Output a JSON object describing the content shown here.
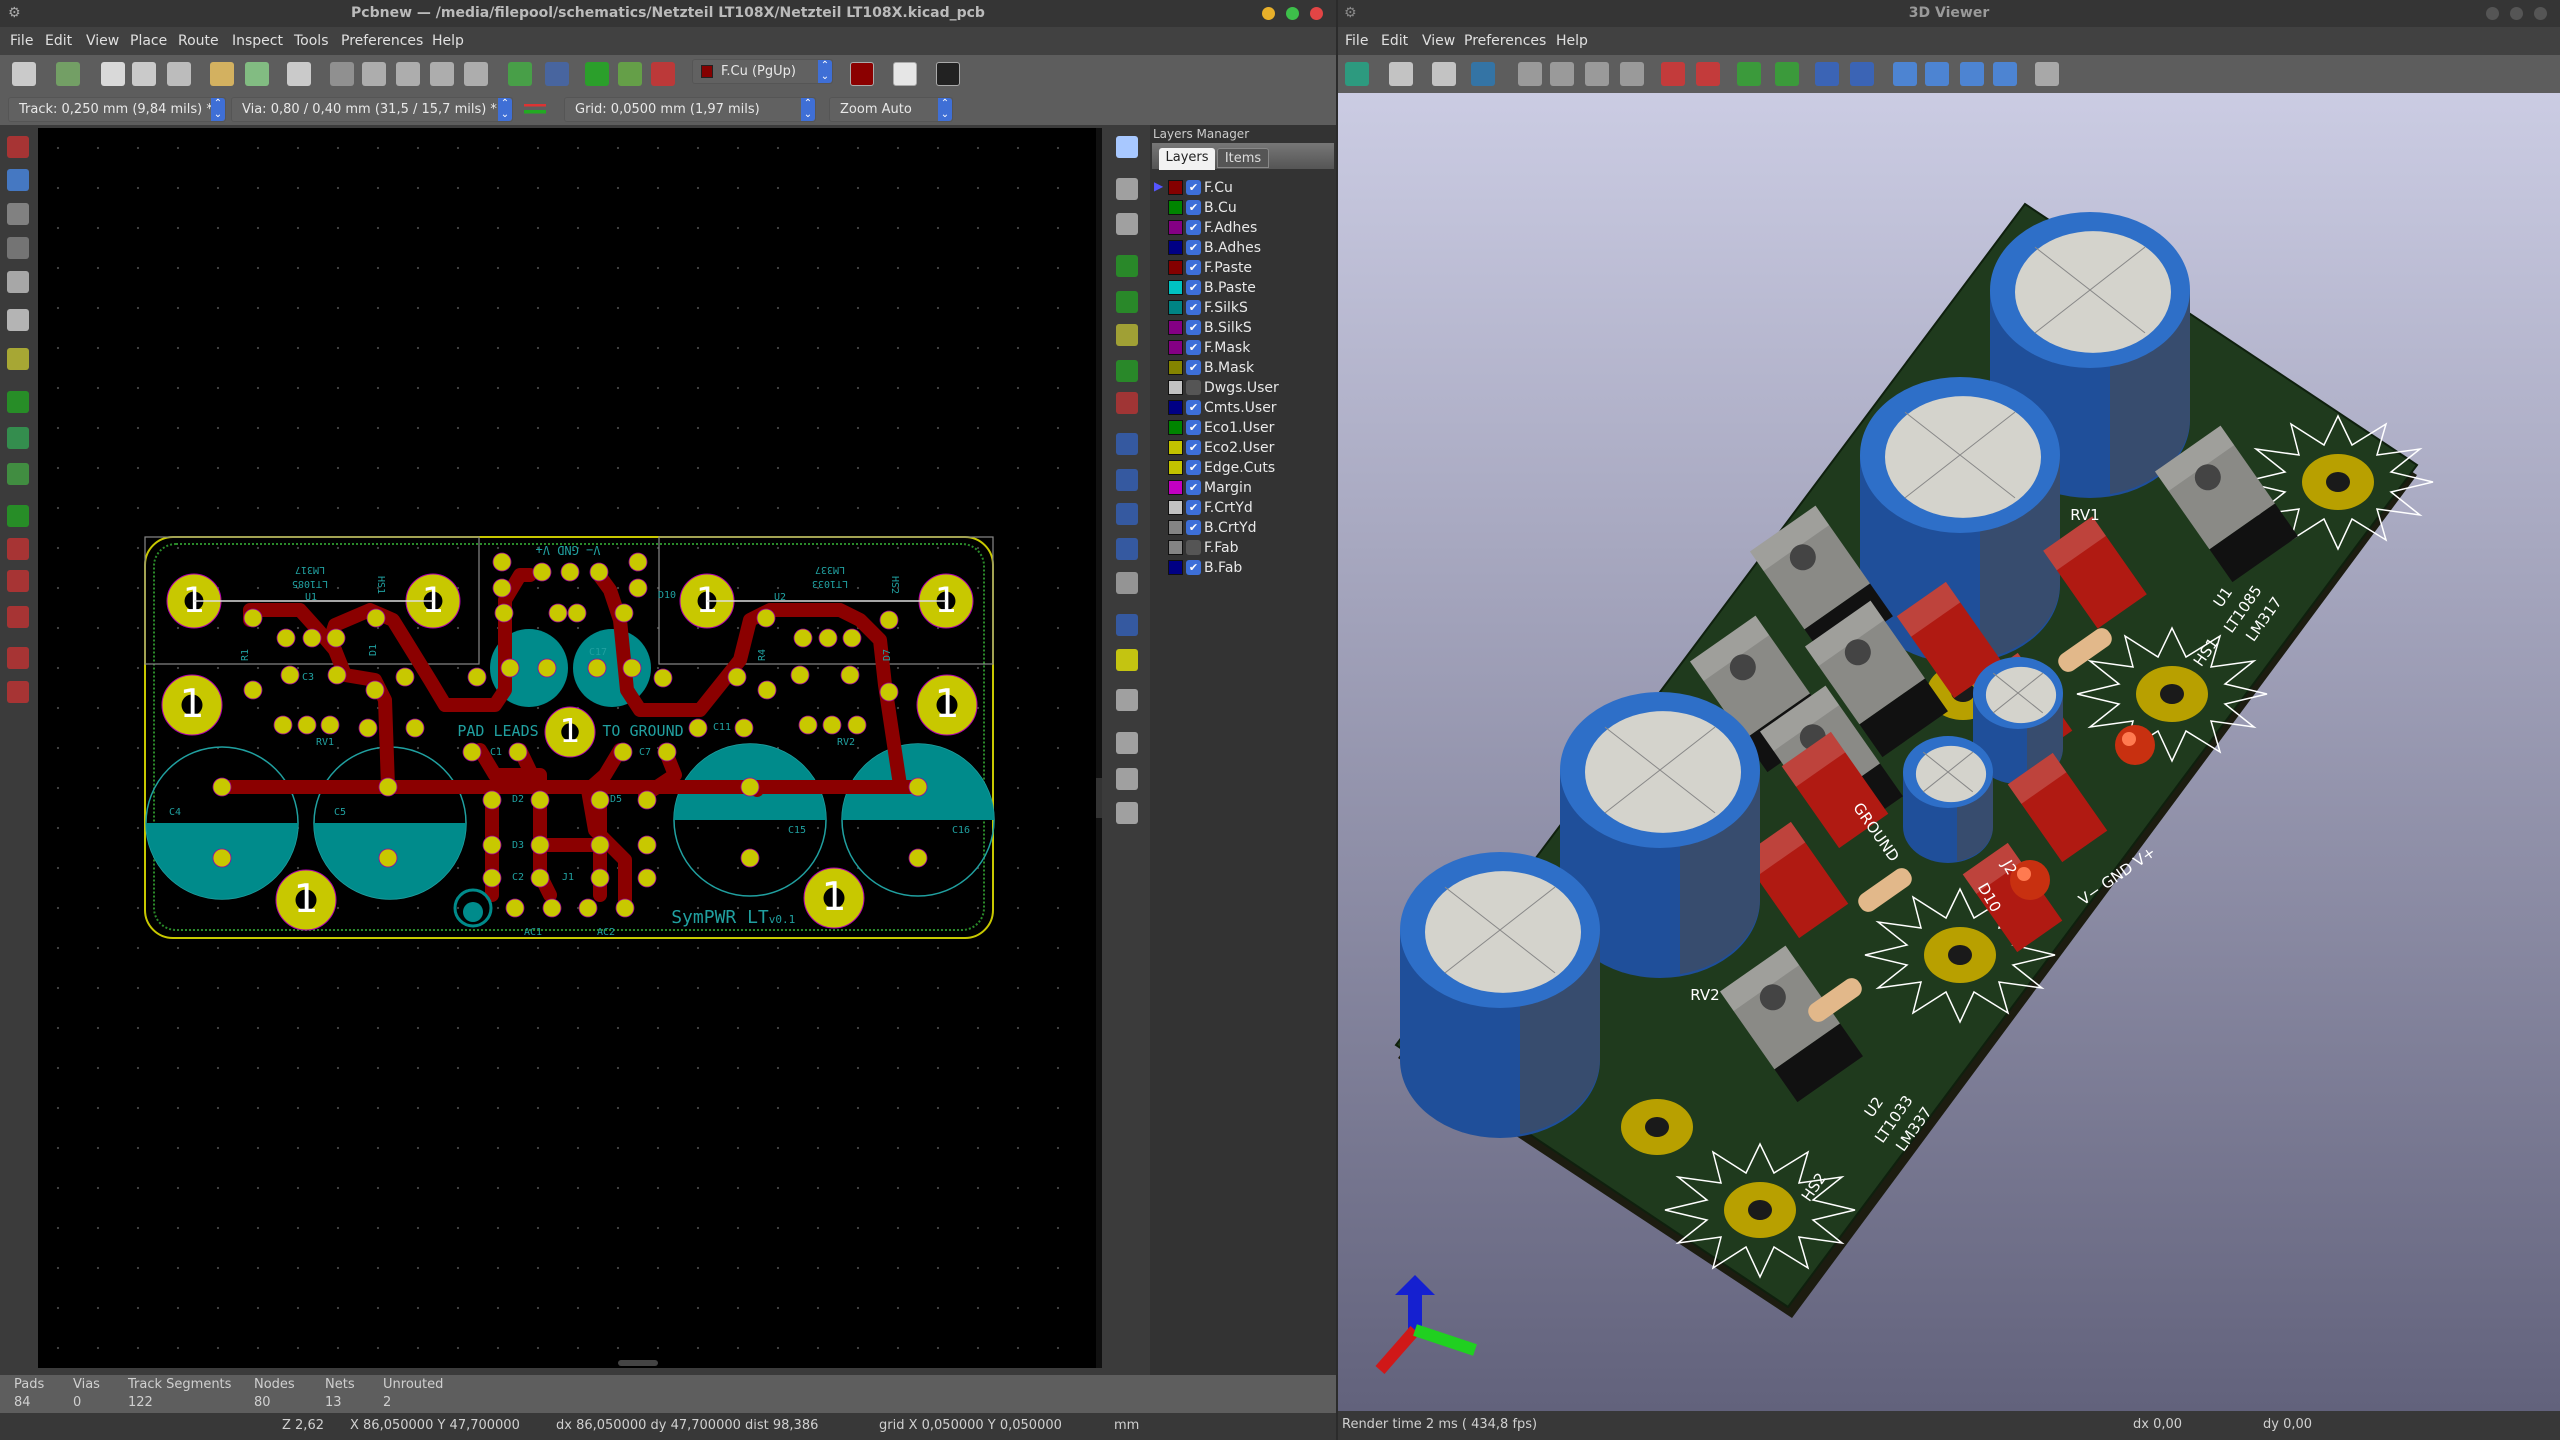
{
  "pcbnew": {
    "title": "Pcbnew — /media/filepool/schematics/Netzteil LT108X/Netzteil LT108X.kicad_pcb",
    "menu": [
      "File",
      "Edit",
      "View",
      "Place",
      "Route",
      "Inspect",
      "Tools",
      "Preferences",
      "Help"
    ],
    "toolbar_icons": [
      "new-board-icon",
      "board-setup-icon",
      "page-settings-icon",
      "print-icon",
      "plot-icon",
      "undo-icon",
      "redo-icon",
      "find-icon",
      "redraw-icon",
      "zoom-in-icon",
      "zoom-out-icon",
      "zoom-fit-icon",
      "zoom-selection-icon",
      "footprint-editor-icon",
      "footprint-browser-icon",
      "netlist-icon",
      "update-pcb-icon",
      "drc-icon"
    ],
    "layer_select": "F.Cu (PgUp)",
    "toolbar_icons_after": [
      "layer-pair-icon",
      "scripting-icon",
      "python-console-icon"
    ],
    "track": "Track: 0,250 mm (9,84 mils) *",
    "via": "Via: 0,80 / 0,40 mm (31,5 / 15,7 mils) *",
    "grid": "Grid: 0,0500 mm (1,97 mils)",
    "zoom": "Zoom Auto",
    "left_tools": [
      "drc-marker-icon",
      "grid-toggle-icon",
      "polar-coords-icon",
      "inch-units-icon",
      "mm-units-icon",
      "cursor-shape-icon",
      "ratsnest-icon",
      "zone-fill-icon",
      "zone-outline-icon",
      "pad-sketch-icon",
      "via-sketch-icon",
      "track-sketch-icon",
      "high-contrast-icon",
      "microwave-icon",
      "layers-manager-toggle-icon",
      "delete-icon"
    ],
    "right_tools": [
      "select-icon",
      "highlight-net-icon",
      "local-ratsnest-icon",
      "add-footprint-icon",
      "route-track-icon",
      "add-via-icon",
      "add-zone-icon",
      "keepout-icon",
      "add-line-icon",
      "add-circle-icon",
      "add-arc-icon",
      "add-polygon-icon",
      "add-text-icon",
      "add-dimension-icon",
      "add-target-icon",
      "delete-tool-icon",
      "set-origin-icon",
      "grid-origin-icon",
      "measure-icon"
    ],
    "layers_manager": {
      "title": "Layers Manager",
      "tabs": [
        "Layers",
        "Items"
      ],
      "layers": [
        {
          "name": "F.Cu",
          "color": "#840000",
          "visible": true
        },
        {
          "name": "B.Cu",
          "color": "#008400",
          "visible": true
        },
        {
          "name": "F.Adhes",
          "color": "#840084",
          "visible": true
        },
        {
          "name": "B.Adhes",
          "color": "#000084",
          "visible": true
        },
        {
          "name": "F.Paste",
          "color": "#840000",
          "visible": true
        },
        {
          "name": "B.Paste",
          "color": "#00c2c2",
          "visible": true
        },
        {
          "name": "F.SilkS",
          "color": "#008484",
          "visible": true
        },
        {
          "name": "B.SilkS",
          "color": "#840084",
          "visible": true
        },
        {
          "name": "F.Mask",
          "color": "#840084",
          "visible": true
        },
        {
          "name": "B.Mask",
          "color": "#848400",
          "visible": true
        },
        {
          "name": "Dwgs.User",
          "color": "#c2c2c2",
          "visible": false
        },
        {
          "name": "Cmts.User",
          "color": "#000084",
          "visible": true
        },
        {
          "name": "Eco1.User",
          "color": "#008400",
          "visible": true
        },
        {
          "name": "Eco2.User",
          "color": "#c2c200",
          "visible": true
        },
        {
          "name": "Edge.Cuts",
          "color": "#c2c200",
          "visible": true
        },
        {
          "name": "Margin",
          "color": "#c200c2",
          "visible": true
        },
        {
          "name": "F.CrtYd",
          "color": "#c2c2c2",
          "visible": true
        },
        {
          "name": "B.CrtYd",
          "color": "#848484",
          "visible": true
        },
        {
          "name": "F.Fab",
          "color": "#848484",
          "visible": false
        },
        {
          "name": "B.Fab",
          "color": "#000084",
          "visible": true
        }
      ]
    },
    "board_text": {
      "pad_leads": "PAD LEADS",
      "to_ground": "TO GROUND",
      "brand": "SymPWR LT",
      "version": "v0.1",
      "connector": "V−  GND  V+",
      "pad_number": "1",
      "refs": [
        "U1",
        "LT1085",
        "LM317",
        "HS1",
        "U2",
        "LT1033",
        "LM337",
        "HS2",
        "C3",
        "RV1",
        "RV2",
        "C11",
        "C17",
        "C1",
        "C7",
        "D2",
        "D5",
        "D3",
        "C2",
        "J1",
        "AC1",
        "AC2",
        "C4",
        "C5",
        "C15",
        "C16",
        "D1",
        "D10",
        "R1",
        "R4",
        "D7"
      ]
    },
    "stats": {
      "headers": [
        "Pads",
        "Vias",
        "Track Segments",
        "Nodes",
        "Nets",
        "Unrouted"
      ],
      "values": [
        "84",
        "0",
        "122",
        "80",
        "13",
        "2"
      ]
    },
    "status": {
      "zoom": "Z 2,62",
      "xy": "X 86,050000  Y 47,700000",
      "dxy": "dx 86,050000  dy 47,700000  dist 98,386",
      "grid": "grid X 0,050000  Y 0,050000",
      "units": "mm"
    }
  },
  "viewer3d": {
    "title": "3D Viewer",
    "menu": [
      "File",
      "Edit",
      "View",
      "Preferences",
      "Help"
    ],
    "toolbar_icons": [
      "reload-board-icon",
      "copy-image-icon",
      "settings-icon",
      "realistic-mode-icon",
      "zoom-in-icon",
      "zoom-out-icon",
      "redraw-icon",
      "zoom-fit-icon",
      "rotate-x-cw-icon",
      "rotate-x-ccw-icon",
      "rotate-y-cw-icon",
      "rotate-y-ccw-icon",
      "rotate-z-cw-icon",
      "rotate-z-ccw-icon",
      "move-left-icon",
      "move-right-icon",
      "move-up-icon",
      "move-down-icon",
      "ortho-toggle-icon"
    ],
    "silk": [
      "GROUND",
      "V−  GND V+",
      "LT1085",
      "LM317",
      "U1",
      "HS1",
      "LT1033",
      "LM337",
      "U2",
      "HS2",
      "RV1",
      "RV2",
      "D10",
      "J2"
    ],
    "status": {
      "render": "Render time 2 ms ( 434,8 fps)",
      "dx": "dx 0,00",
      "dy": "dy 0,00"
    }
  }
}
